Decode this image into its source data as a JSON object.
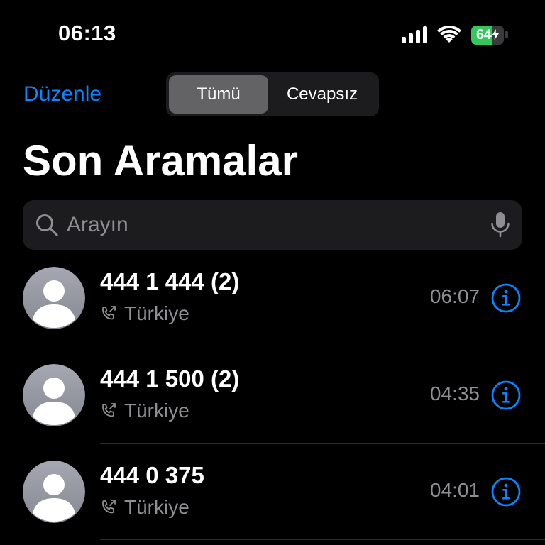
{
  "status_bar": {
    "time": "06:13",
    "battery_level": 64,
    "battery_text": "64",
    "charging": true
  },
  "header": {
    "edit_label": "Düzenle",
    "segments": [
      {
        "label": "Tümü",
        "selected": true
      },
      {
        "label": "Cevapsız",
        "selected": false
      }
    ],
    "title": "Son Aramalar"
  },
  "search": {
    "placeholder": "Arayın",
    "value": ""
  },
  "calls": [
    {
      "number": "444 1 444 (2)",
      "location": "Türkiye",
      "time": "06:07"
    },
    {
      "number": "444 1 500 (2)",
      "location": "Türkiye",
      "time": "04:35"
    },
    {
      "number": "444 0 375",
      "location": "Türkiye",
      "time": "04:01"
    }
  ],
  "colors": {
    "accent": "#0a84ff",
    "background": "#000000",
    "secondary_text": "#8e8e93",
    "battery_green": "#34c759"
  },
  "icons": {
    "signal": "cellular-signal-icon",
    "wifi": "wifi-icon",
    "battery": "battery-charging-icon",
    "search": "magnifying-glass-icon",
    "mic": "microphone-icon",
    "avatar": "person-placeholder-icon",
    "outgoing": "outgoing-call-icon",
    "info": "info-circle-icon"
  }
}
